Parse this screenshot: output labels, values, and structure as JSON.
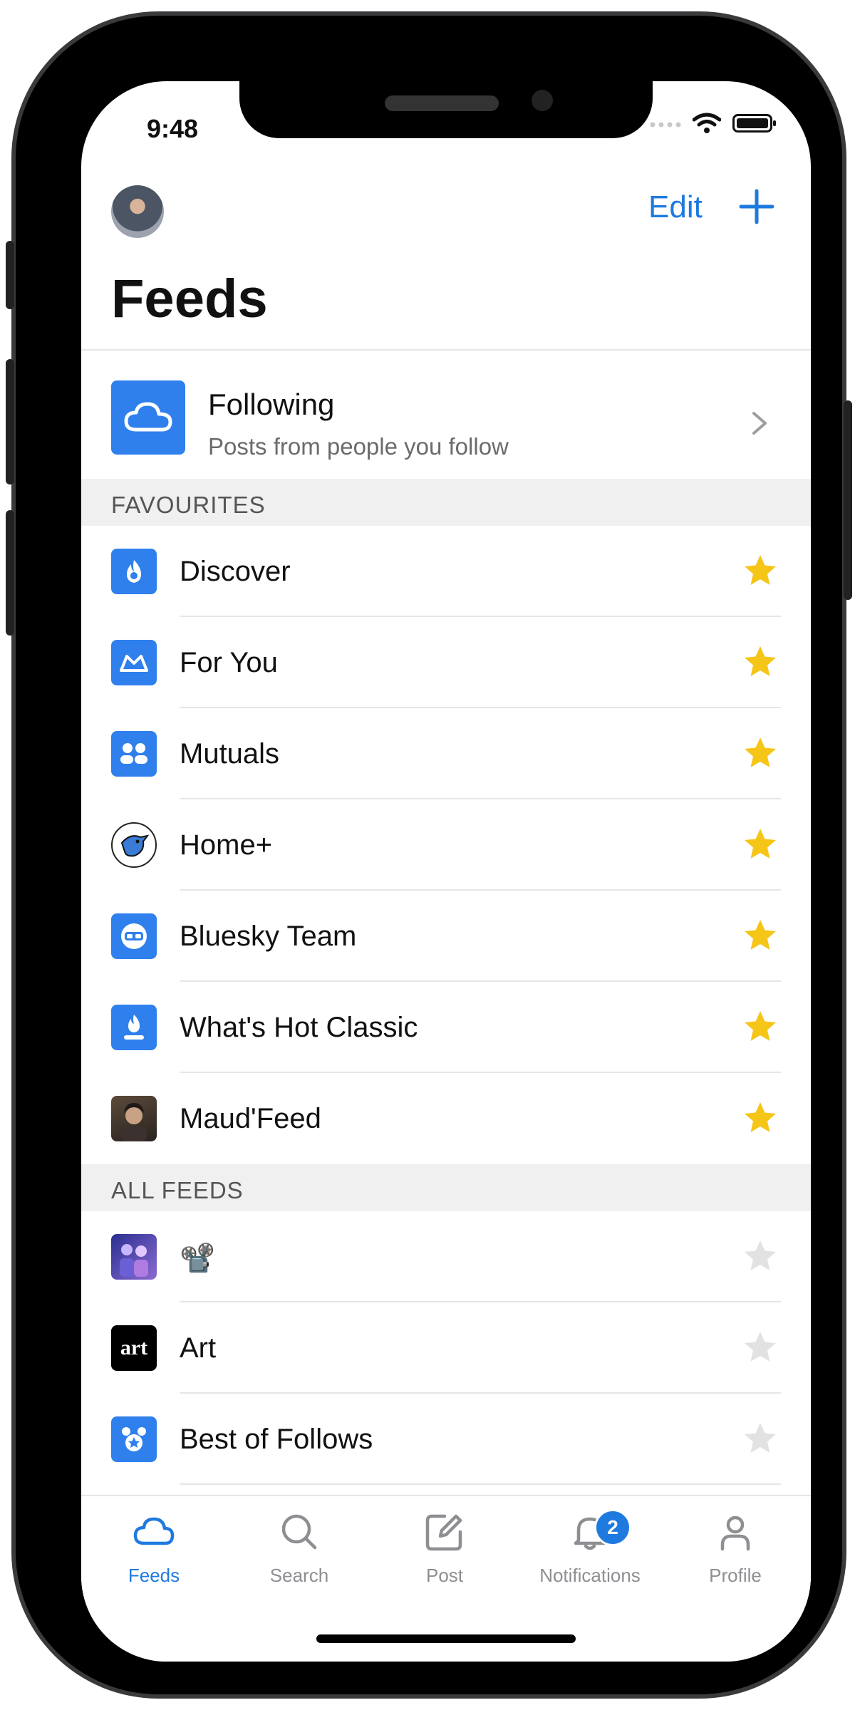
{
  "status_bar": {
    "time": "9:48"
  },
  "header": {
    "title": "Feeds",
    "edit_label": "Edit"
  },
  "following": {
    "title": "Following",
    "subtitle": "Posts from people you follow"
  },
  "sections": {
    "favourites": {
      "label": "FAVOURITES",
      "items": [
        {
          "label": "Discover",
          "icon": "discover-icon",
          "starred": true
        },
        {
          "label": "For You",
          "icon": "for-you-icon",
          "starred": true
        },
        {
          "label": "Mutuals",
          "icon": "mutuals-icon",
          "starred": true
        },
        {
          "label": "Home+",
          "icon": "bird-icon",
          "starred": true
        },
        {
          "label": "Bluesky Team",
          "icon": "bluesky-team-icon",
          "starred": true
        },
        {
          "label": "What's Hot Classic",
          "icon": "whats-hot-classic-icon",
          "starred": true
        },
        {
          "label": "Maud'Feed",
          "icon": "portrait-icon",
          "starred": true
        }
      ]
    },
    "all_feeds": {
      "label": "ALL FEEDS",
      "items": [
        {
          "label": "📽️",
          "icon": "people-photo-icon",
          "starred": false
        },
        {
          "label": "Art",
          "icon": "art-logo-icon",
          "icon_text": "art",
          "starred": false
        },
        {
          "label": "Best of Follows",
          "icon": "best-of-follows-icon",
          "starred": false
        }
      ]
    }
  },
  "tabbar": {
    "feeds": "Feeds",
    "search": "Search",
    "post": "Post",
    "notifications": "Notifications",
    "notifications_badge": "2",
    "profile": "Profile"
  },
  "colors": {
    "accent": "#1f7ae0",
    "star_active": "#f5c518",
    "star_inactive": "#e2e2e2",
    "section_bg": "#f0f0f0"
  }
}
